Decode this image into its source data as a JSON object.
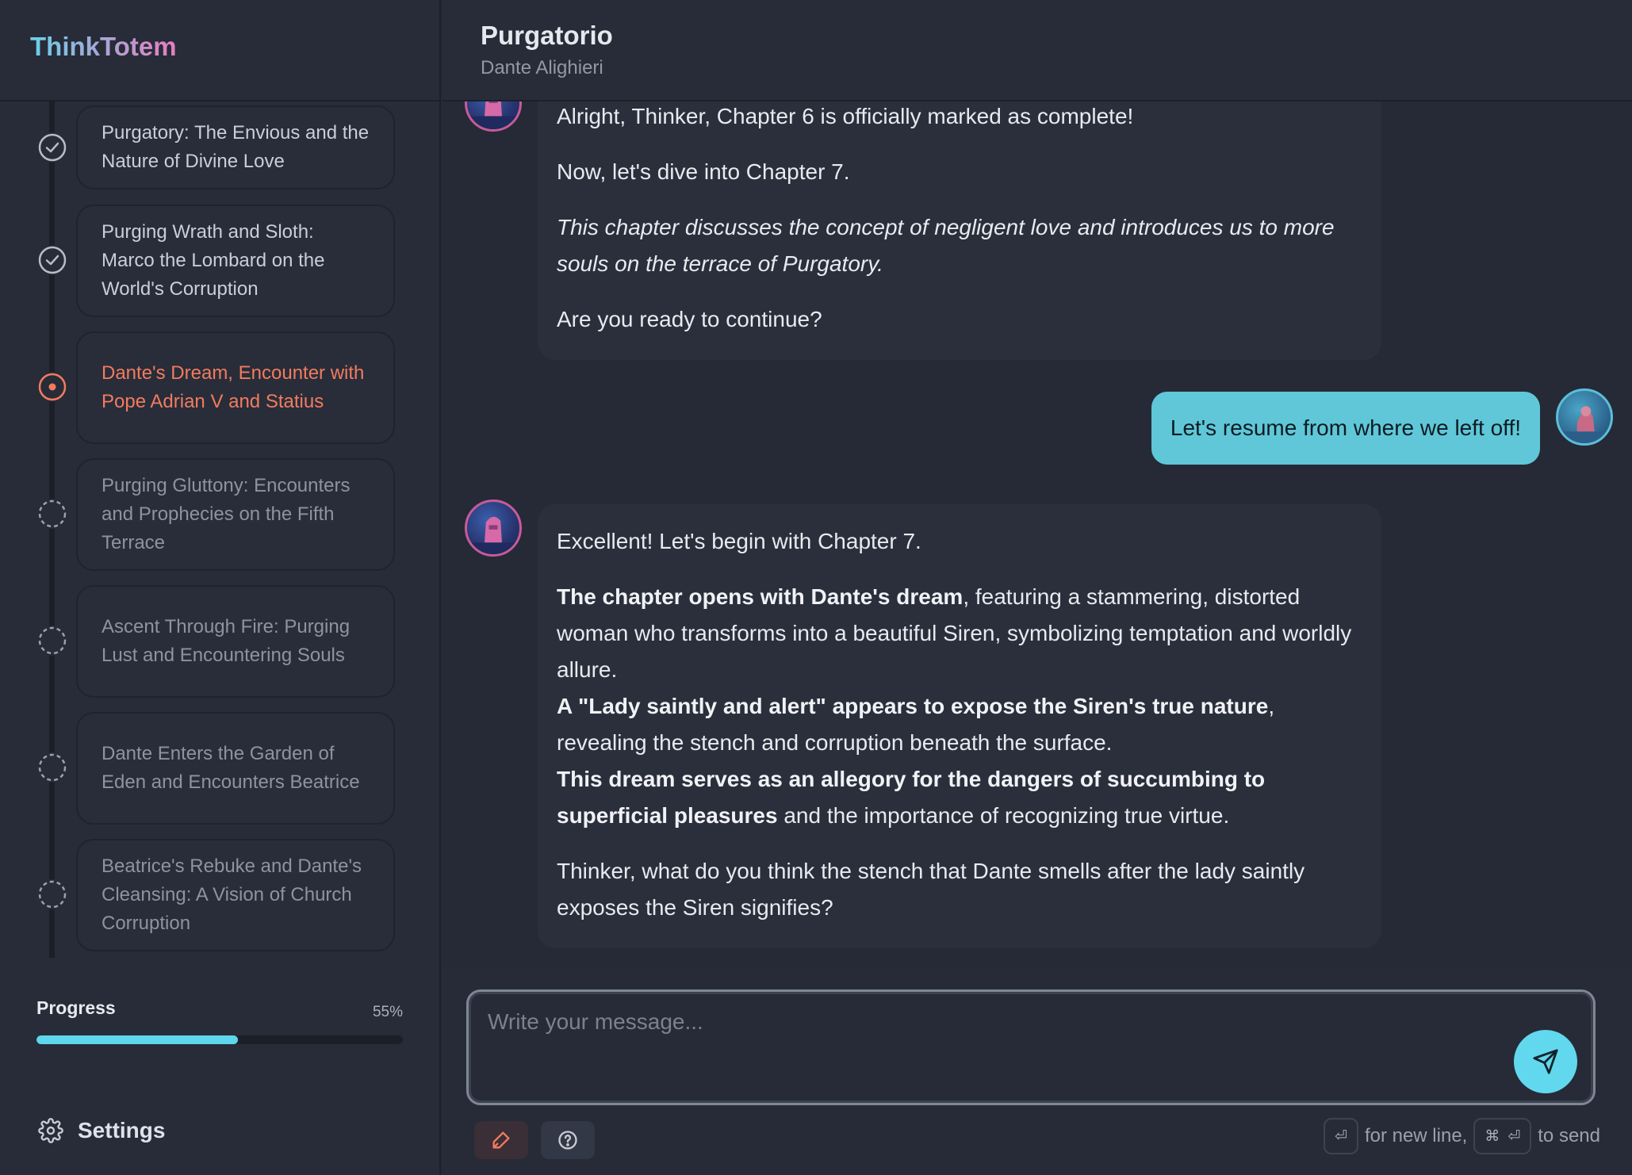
{
  "app": {
    "brand": "ThinkTotem"
  },
  "book": {
    "title": "Purgatorio",
    "author": "Dante Alighieri"
  },
  "chapters": [
    {
      "title": "Purgatory: The Envious and the Nature of Divine Love",
      "status": "completed"
    },
    {
      "title": "Purging Wrath and Sloth: Marco the Lombard on the World's Corruption",
      "status": "completed"
    },
    {
      "title": "Dante's Dream, Encounter with Pope Adrian V and Statius",
      "status": "current"
    },
    {
      "title": "Purging Gluttony: Encounters and Prophecies on the Fifth Terrace",
      "status": "pending"
    },
    {
      "title": "Ascent Through Fire: Purging Lust and Encountering Souls",
      "status": "pending"
    },
    {
      "title": "Dante Enters the Garden of Eden and Encounters Beatrice",
      "status": "pending"
    },
    {
      "title": "Beatrice's Rebuke and Dante's Cleansing: A Vision of Church Corruption",
      "status": "pending"
    }
  ],
  "progress": {
    "label": "Progress",
    "percent_text": "55%",
    "value": 0.55
  },
  "settings": {
    "label": "Settings"
  },
  "messages": {
    "m1": {
      "p1": "Alright, Thinker, Chapter 6 is officially marked as complete!",
      "p2": "Now, let's dive into Chapter 7.",
      "p3": "This chapter discusses the concept of negligent love and introduces us to more souls on the terrace of Purgatory.",
      "p4": "Are you ready to continue?"
    },
    "user": {
      "text": "Let's resume from where we left off!"
    },
    "m2": {
      "p1": "Excellent! Let's begin with Chapter 7.",
      "p2_bold": "The chapter opens with Dante's dream",
      "p2_rest": ", featuring a stammering, distorted woman who transforms into a beautiful Siren, symbolizing temptation and worldly allure.",
      "p2b_bold": "A \"Lady saintly and alert\" appears to expose the Siren's true nature",
      "p2b_rest": ", revealing the stench and corruption beneath the surface.",
      "p2c_bold": "This dream serves as an allegory for the dangers of succumbing to superficial pleasures",
      "p2c_rest": " and the importance of recognizing true virtue.",
      "p3": "Thinker, what do you think the stench that Dante smells after the lady saintly exposes the Siren signifies?"
    }
  },
  "composer": {
    "placeholder": "Write your message...",
    "hint_new_line": "for new line,",
    "hint_send": "to send",
    "key_enter": "⏎",
    "key_cmd": "⌘"
  },
  "colors": {
    "accent": "#5ed6ec",
    "current": "#f27b5f",
    "user_bubble": "#5fc7d8"
  },
  "icons": {
    "completed": "check-circle-icon",
    "current": "dot-circle-icon",
    "pending": "dashed-circle-icon"
  }
}
